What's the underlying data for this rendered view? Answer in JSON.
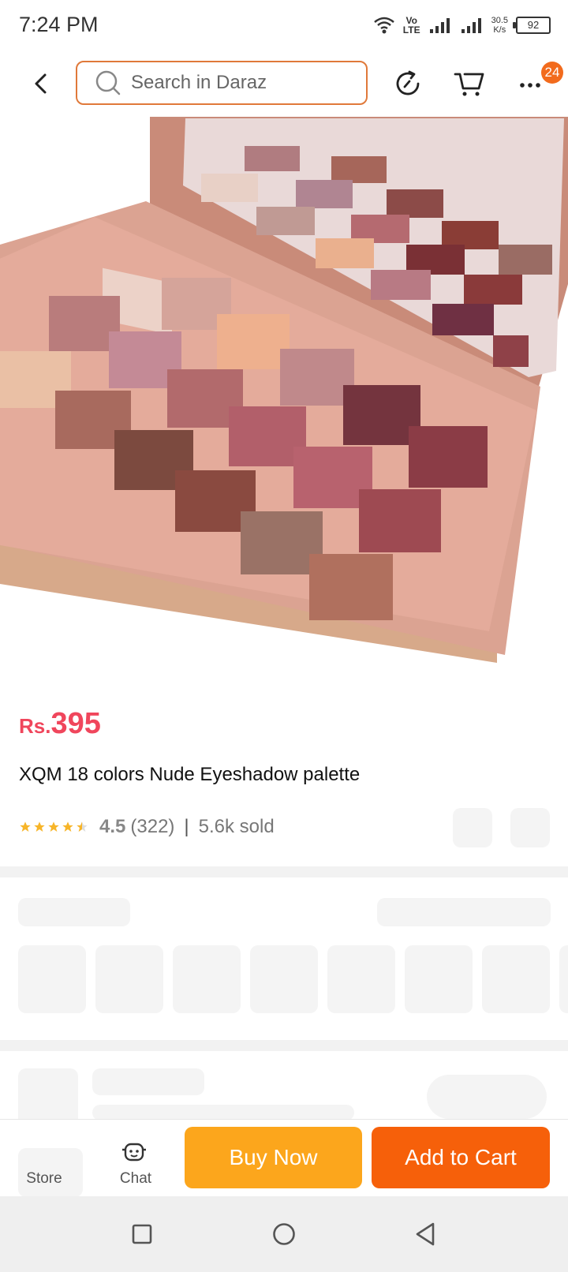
{
  "status_bar": {
    "time": "7:24 PM",
    "network_label_top": "Vo",
    "network_label_bottom": "LTE",
    "speed_value": "30.5",
    "speed_unit": "K/s",
    "battery": "92"
  },
  "header": {
    "search_placeholder": "Search in Daraz",
    "cart_badge": "24"
  },
  "product": {
    "currency": "Rs.",
    "price": "395",
    "title": "XQM 18 colors Nude Eyeshadow palette",
    "rating": "4.5",
    "review_count": "(322)",
    "separator": "|",
    "sold": "5.6k sold",
    "star_fill": 4.5
  },
  "bottom_bar": {
    "store_label": "Store",
    "chat_label": "Chat",
    "buy_now": "Buy Now",
    "add_to_cart": "Add to Cart"
  },
  "colors": {
    "accent_orange": "#f6600a",
    "buy_yellow": "#fca61c",
    "price_red": "#f0465c",
    "search_border": "#e0793a"
  }
}
